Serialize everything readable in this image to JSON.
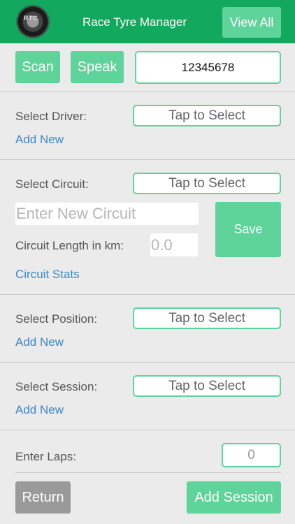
{
  "appbar": {
    "title": "Race Tyre Manager",
    "view_all": "View All",
    "logo_text": "RTC"
  },
  "scan_row": {
    "scan": "Scan",
    "speak": "Speak",
    "serial": "12345678"
  },
  "driver": {
    "label": "Select Driver:",
    "select": "Tap to Select",
    "add": "Add New"
  },
  "circuit": {
    "label": "Select Circuit:",
    "select": "Tap to Select",
    "new_placeholder": "Enter New Circuit",
    "length_label": "Circuit Length in km:",
    "length_placeholder": "0.0",
    "save": "Save",
    "stats": "Circuit Stats"
  },
  "position": {
    "label": "Select Position:",
    "select": "Tap to Select",
    "add": "Add New"
  },
  "session": {
    "label": "Select Session:",
    "select": "Tap to Select",
    "add": "Add New"
  },
  "laps": {
    "label": "Enter Laps:",
    "placeholder": "0"
  },
  "footer": {
    "return": "Return",
    "add_session": "Add Session"
  },
  "colors": {
    "brand": "#12a85e",
    "button": "#5ed39a",
    "link": "#3c89c9",
    "return": "#9a9a9a"
  }
}
